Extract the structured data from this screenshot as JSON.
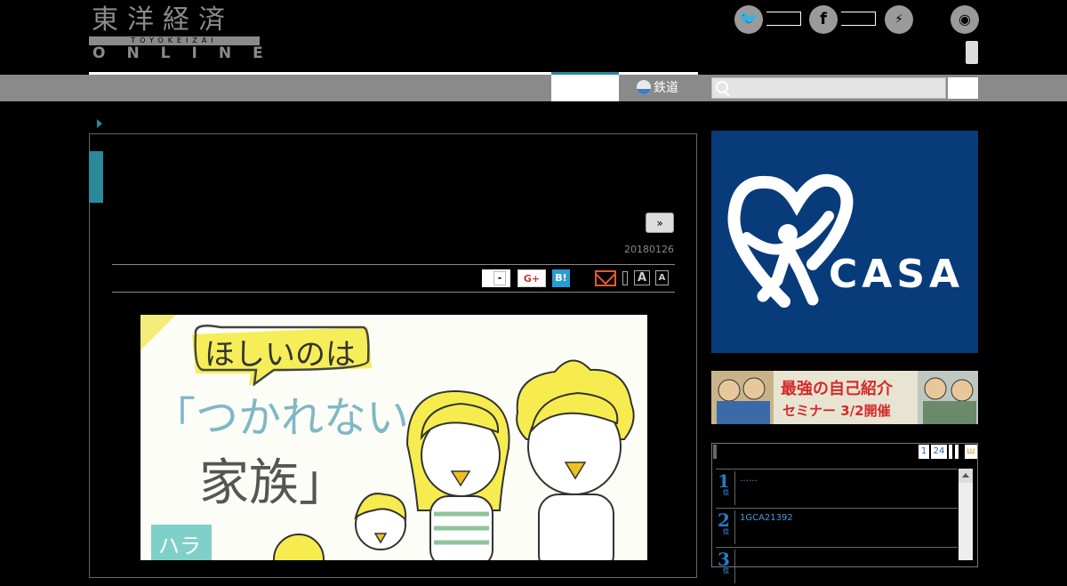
{
  "header": {
    "logo_kanji": "東洋経済",
    "logo_romaji": "TOYOKEIZAI",
    "logo_sub": "ONLINE",
    "social": [
      {
        "name": "twitter",
        "icon": "twitter-bird-icon",
        "glyph": "🐦"
      },
      {
        "name": "facebook",
        "icon": "facebook-f-icon",
        "glyph": "f"
      },
      {
        "name": "messenger",
        "icon": "messenger-icon",
        "glyph": "⚡"
      },
      {
        "name": "rss",
        "icon": "rss-icon",
        "glyph": "◉"
      }
    ]
  },
  "nav": {
    "rail_label": "鉄道",
    "rail_icon": "train-icon",
    "accent_color": "#2a8a99"
  },
  "article": {
    "next_label": "»",
    "date": "20180126",
    "share": {
      "tweet_label": "-",
      "gplus_label": "G+",
      "hatena_label": "B!",
      "font_large": "A",
      "font_small": "A"
    },
    "illustration": {
      "bubble_text": "ほしいのは",
      "title_line1": "「つかれない",
      "title_line2": "家族」",
      "tag_text": "ハラ"
    }
  },
  "sidebar": {
    "ad1_text": "CASA",
    "ad1_mark": "®",
    "ad2_text_line1": "最強の自己紹介",
    "ad2_text_line2": "セミナー 3/2開催",
    "ranking_tabs": [
      "1",
      "24"
    ],
    "ranking_tab_last": "ш",
    "ranking": [
      {
        "rank": "1",
        "unit": "位",
        "text": "……"
      },
      {
        "rank": "2",
        "unit": "位",
        "text": "1GCA21392"
      },
      {
        "rank": "3",
        "unit": "位",
        "text": ""
      }
    ]
  }
}
